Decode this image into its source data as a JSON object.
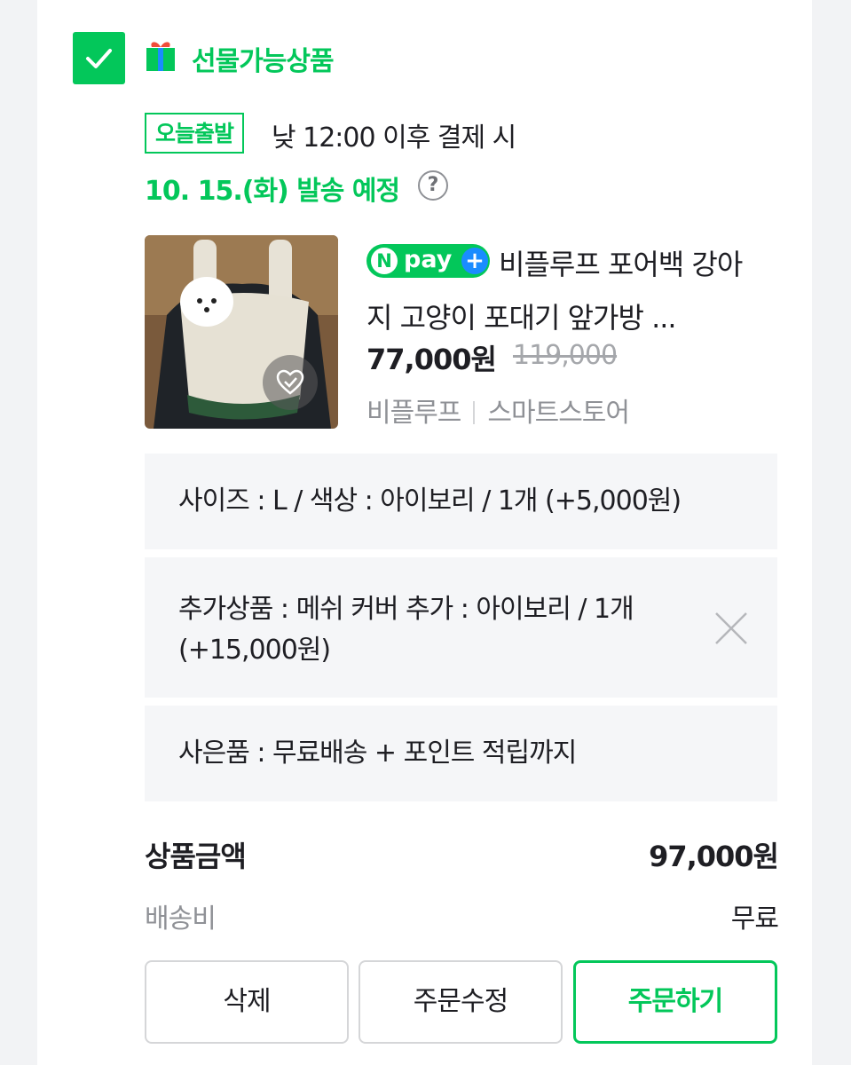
{
  "gift": {
    "label": "선물가능상품"
  },
  "shipping_info": {
    "badge": "오늘출발",
    "description": "낮 12:00 이후 결제 시",
    "date": "10. 15.(화) 발송 예정",
    "help": "?"
  },
  "product": {
    "npay_badge": {
      "n": "N",
      "pay": "pay",
      "plus": "+"
    },
    "name": "비플루프 포어백 강아지 고양이 포대기 앞가방 ...",
    "price": "77,000원",
    "original_price": "119,000",
    "seller": "비플루프",
    "store_type": "스마트스토어",
    "image_alt": "product-photo-dog-carrier"
  },
  "options": [
    {
      "text": "사이즈 : L / 색상 : 아이보리 / 1개 (+5,000원)"
    },
    {
      "text": "추가상품 : 메쉬 커버 추가 : 아이보리 / 1개 (+15,000원)"
    },
    {
      "text": "사은품 : 무료배송 + 포인트 적립까지"
    }
  ],
  "summary": {
    "product_amount_label": "상품금액",
    "product_amount": "97,000원",
    "shipping_label": "배송비",
    "shipping_value": "무료"
  },
  "buttons": {
    "delete": "삭제",
    "edit": "주문수정",
    "order": "주문하기"
  },
  "colors": {
    "accent": "#03c75a",
    "npay_plus": "#1a8cff",
    "option_bg": "#f5f6f8"
  }
}
